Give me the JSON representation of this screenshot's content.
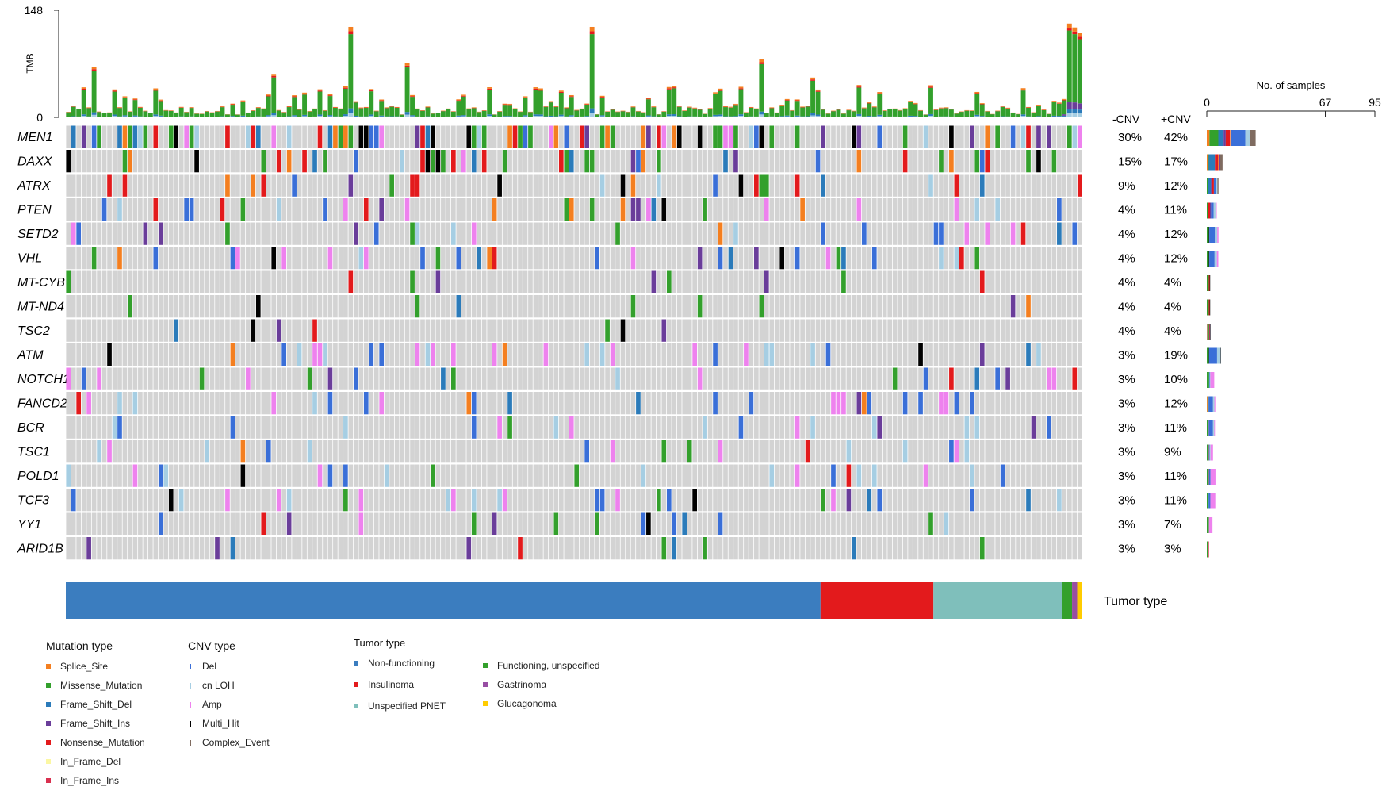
{
  "chart_data": {
    "type": "oncoplot",
    "tmb_axis": {
      "label": "TMB",
      "min": 0,
      "max": 148,
      "ticks": [
        "0",
        "148"
      ]
    },
    "samples_axis": {
      "label": "No. of samples",
      "min": 0,
      "max": 95,
      "ticks": [
        "0",
        "67",
        "95"
      ]
    },
    "cnv_headers": [
      "-CNV",
      "+CNV"
    ],
    "genes": [
      {
        "name": "MEN1",
        "minus_cnv": "30%",
        "plus_cnv": "42%",
        "bar": [
          {
            "t": "Splice_Site",
            "v": 1.5
          },
          {
            "t": "Missense_Mutation",
            "v": 5
          },
          {
            "t": "Frame_Shift_Del",
            "v": 3
          },
          {
            "t": "Frame_Shift_Ins",
            "v": 1.2
          },
          {
            "t": "Nonsense_Mutation",
            "v": 2.5
          },
          {
            "t": "In_Frame_Del",
            "v": 0.3
          },
          {
            "t": "Multi_Hit",
            "v": 0.3
          },
          {
            "t": "Del",
            "v": 8
          },
          {
            "t": "cnLOH",
            "v": 2.5
          },
          {
            "t": "Multi_Hit",
            "v": 0.3
          },
          {
            "t": "Complex_Event",
            "v": 3
          }
        ]
      },
      {
        "name": "DAXX",
        "minus_cnv": "15%",
        "plus_cnv": "17%",
        "bar": [
          {
            "t": "Splice_Site",
            "v": 0.6
          },
          {
            "t": "Missense_Mutation",
            "v": 0.5
          },
          {
            "t": "Frame_Shift_Del",
            "v": 3.5
          },
          {
            "t": "Nonsense_Mutation",
            "v": 1.8
          },
          {
            "t": "Splice_Site",
            "v": 0.4
          },
          {
            "t": "Multi_Hit",
            "v": 0.3
          },
          {
            "t": "Frame_Shift_Ins",
            "v": 0.5
          },
          {
            "t": "Complex_Event",
            "v": 1.3
          }
        ]
      },
      {
        "name": "ATRX",
        "minus_cnv": "9%",
        "plus_cnv": "12%",
        "bar": [
          {
            "t": "Missense_Mutation",
            "v": 0.8
          },
          {
            "t": "Frame_Shift_Del",
            "v": 1.5
          },
          {
            "t": "Frame_Shift_Ins",
            "v": 0.8
          },
          {
            "t": "Nonsense_Mutation",
            "v": 0.9
          },
          {
            "t": "Del",
            "v": 1.2
          },
          {
            "t": "cnLOH",
            "v": 0.8
          },
          {
            "t": "Complex_Event",
            "v": 0.6
          }
        ]
      },
      {
        "name": "PTEN",
        "minus_cnv": "4%",
        "plus_cnv": "11%",
        "bar": [
          {
            "t": "Missense_Mutation",
            "v": 0.8
          },
          {
            "t": "Nonsense_Mutation",
            "v": 1
          },
          {
            "t": "Frame_Shift_Ins",
            "v": 0.6
          },
          {
            "t": "Del",
            "v": 1.5
          },
          {
            "t": "cnLOH",
            "v": 1
          },
          {
            "t": "Amp",
            "v": 0.7
          }
        ]
      },
      {
        "name": "SETD2",
        "minus_cnv": "4%",
        "plus_cnv": "12%",
        "bar": [
          {
            "t": "Missense_Mutation",
            "v": 1.1
          },
          {
            "t": "Multi_Hit",
            "v": 0.3
          },
          {
            "t": "Del",
            "v": 3.2
          },
          {
            "t": "cnLOH",
            "v": 1.3
          },
          {
            "t": "Amp",
            "v": 0.7
          }
        ]
      },
      {
        "name": "VHL",
        "minus_cnv": "4%",
        "plus_cnv": "12%",
        "bar": [
          {
            "t": "Missense_Mutation",
            "v": 1.1
          },
          {
            "t": "Multi_Hit",
            "v": 0.3
          },
          {
            "t": "Del",
            "v": 3
          },
          {
            "t": "cnLOH",
            "v": 1.3
          },
          {
            "t": "Amp",
            "v": 0.8
          }
        ]
      },
      {
        "name": "MT-CYB",
        "minus_cnv": "4%",
        "plus_cnv": "4%",
        "bar": [
          {
            "t": "Missense_Mutation",
            "v": 1.1
          },
          {
            "t": "Nonsense_Mutation",
            "v": 0.5
          },
          {
            "t": "Multi_Hit",
            "v": 0.3
          }
        ]
      },
      {
        "name": "MT-ND4",
        "minus_cnv": "4%",
        "plus_cnv": "4%",
        "bar": [
          {
            "t": "Missense_Mutation",
            "v": 1.1
          },
          {
            "t": "Nonsense_Mutation",
            "v": 0.5
          },
          {
            "t": "Multi_Hit",
            "v": 0.3
          }
        ]
      },
      {
        "name": "TSC2",
        "minus_cnv": "4%",
        "plus_cnv": "4%",
        "bar": [
          {
            "t": "Splice_Site",
            "v": 0.3
          },
          {
            "t": "Frame_Shift_Del",
            "v": 0.5
          },
          {
            "t": "Missense_Mutation",
            "v": 0.5
          },
          {
            "t": "Nonsense_Mutation",
            "v": 0.3
          },
          {
            "t": "Frame_Shift_Ins",
            "v": 0.3
          },
          {
            "t": "Multi_Hit",
            "v": 0.2
          }
        ]
      },
      {
        "name": "ATM",
        "minus_cnv": "3%",
        "plus_cnv": "19%",
        "bar": [
          {
            "t": "Missense_Mutation",
            "v": 1.1
          },
          {
            "t": "Multi_Hit",
            "v": 0.2
          },
          {
            "t": "Del",
            "v": 4.5
          },
          {
            "t": "cnLOH",
            "v": 2
          },
          {
            "t": "Multi_Hit",
            "v": 0.2
          }
        ]
      },
      {
        "name": "NOTCH1",
        "minus_cnv": "3%",
        "plus_cnv": "10%",
        "bar": [
          {
            "t": "Missense_Mutation",
            "v": 1.3
          },
          {
            "t": "Del",
            "v": 0.4
          },
          {
            "t": "cnLOH",
            "v": 0.3
          },
          {
            "t": "Amp",
            "v": 2.2
          }
        ]
      },
      {
        "name": "FANCD2",
        "minus_cnv": "3%",
        "plus_cnv": "12%",
        "bar": [
          {
            "t": "Splice_Site",
            "v": 0.4
          },
          {
            "t": "Missense_Mutation",
            "v": 0.6
          },
          {
            "t": "Del",
            "v": 2.5
          },
          {
            "t": "cnLOH",
            "v": 0.8
          },
          {
            "t": "Amp",
            "v": 0.5
          }
        ]
      },
      {
        "name": "BCR",
        "minus_cnv": "3%",
        "plus_cnv": "11%",
        "bar": [
          {
            "t": "Missense_Mutation",
            "v": 1
          },
          {
            "t": "Frame_Shift_Ins",
            "v": 0.2
          },
          {
            "t": "Del",
            "v": 2.3
          },
          {
            "t": "cnLOH",
            "v": 0.7
          },
          {
            "t": "Amp",
            "v": 0.4
          }
        ]
      },
      {
        "name": "TSC1",
        "minus_cnv": "3%",
        "plus_cnv": "9%",
        "bar": [
          {
            "t": "Missense_Mutation",
            "v": 0.8
          },
          {
            "t": "Splice_Site",
            "v": 0.3
          },
          {
            "t": "Del",
            "v": 0.5
          },
          {
            "t": "cnLOH",
            "v": 0.5
          },
          {
            "t": "Amp",
            "v": 1.4
          }
        ]
      },
      {
        "name": "POLD1",
        "minus_cnv": "3%",
        "plus_cnv": "11%",
        "bar": [
          {
            "t": "Missense_Mutation",
            "v": 0.8
          },
          {
            "t": "Splice_Site",
            "v": 0.3
          },
          {
            "t": "Del",
            "v": 1
          },
          {
            "t": "Amp",
            "v": 2.8
          }
        ]
      },
      {
        "name": "TCF3",
        "minus_cnv": "3%",
        "plus_cnv": "11%",
        "bar": [
          {
            "t": "Missense_Mutation",
            "v": 1
          },
          {
            "t": "Del",
            "v": 1
          },
          {
            "t": "Amp",
            "v": 2.8
          }
        ]
      },
      {
        "name": "YY1",
        "minus_cnv": "3%",
        "plus_cnv": "7%",
        "bar": [
          {
            "t": "Missense_Mutation",
            "v": 1.2
          },
          {
            "t": "Amp",
            "v": 2
          }
        ]
      },
      {
        "name": "ARID1B",
        "minus_cnv": "3%",
        "plus_cnv": "3%",
        "bar": [
          {
            "t": "Missense_Mutation",
            "v": 0.5
          },
          {
            "t": "In_Frame_Del",
            "v": 0.4
          },
          {
            "t": "In_Frame_Ins",
            "v": 0.3
          }
        ]
      }
    ],
    "tumor_type_label": "Tumor  type",
    "tumor_types": [
      {
        "name": "Non-functioning",
        "color": "#3b7dbf",
        "samples": 147
      },
      {
        "name": "Insulinoma",
        "color": "#e31a1c",
        "samples": 22
      },
      {
        "name": "Unspecified PNET",
        "color": "#7fbfbb",
        "samples": 25
      },
      {
        "name": "Functioning, unspecified",
        "color": "#33a02c",
        "samples": 2
      },
      {
        "name": "Gastrinoma",
        "color": "#984ea3",
        "samples": 1
      },
      {
        "name": "Glucagonoma",
        "color": "#ffcc00",
        "samples": 1
      }
    ],
    "mutation_legend": {
      "title": "Mutation type",
      "items": [
        {
          "name": "Splice_Site",
          "color": "#f47f20"
        },
        {
          "name": "Missense_Mutation",
          "color": "#33a02c"
        },
        {
          "name": "Frame_Shift_Del",
          "color": "#2b7bba"
        },
        {
          "name": "Frame_Shift_Ins",
          "color": "#6a3d9a"
        },
        {
          "name": "Nonsense_Mutation",
          "color": "#e31a1c"
        },
        {
          "name": "In_Frame_Del",
          "color": "#fbf7a3"
        },
        {
          "name": "In_Frame_Ins",
          "color": "#d9304f"
        }
      ]
    },
    "cnv_legend": {
      "title": "CNV type",
      "items": [
        {
          "name": "Del",
          "color": "#3a6fd8"
        },
        {
          "name": "cn LOH",
          "color": "#a6cee3"
        },
        {
          "name": "Amp",
          "color": "#ee82ee"
        },
        {
          "name": "Multi_Hit",
          "color": "#000000"
        },
        {
          "name": "Complex_Event",
          "color": "#7f6b60"
        }
      ]
    },
    "tumor_legend": {
      "title": "Tumor  type"
    }
  }
}
